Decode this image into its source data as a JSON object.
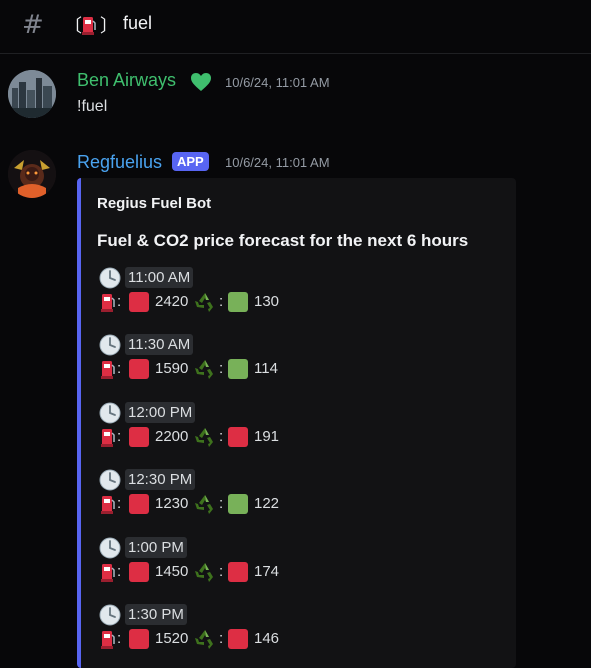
{
  "channel": {
    "name": "fuel",
    "open_bracket": "〔",
    "close_bracket": "〕",
    "hash_icon": "hash-icon",
    "emoji_icon": "fuel-pump-icon"
  },
  "messages": [
    {
      "author": "Ben Airways",
      "author_color": "#3fbf6e",
      "badge_icon": "green-heart-icon",
      "timestamp": "10/6/24, 11:01 AM",
      "text": "!fuel"
    },
    {
      "author": "Regfuelius",
      "author_color": "#4aa3f0",
      "badge": "APP",
      "timestamp": "10/6/24, 11:01 AM"
    }
  ],
  "embed": {
    "accent_color": "#5865f2",
    "author": "Regius Fuel Bot",
    "title": "Fuel & CO2 price forecast for the next 6 hours",
    "slots": [
      {
        "time": "11:00 AM",
        "fuel": "2420",
        "fuel_status": "red",
        "co2": "130",
        "co2_status": "green"
      },
      {
        "time": "11:30 AM",
        "fuel": "1590",
        "fuel_status": "red",
        "co2": "114",
        "co2_status": "green"
      },
      {
        "time": "12:00 PM",
        "fuel": "2200",
        "fuel_status": "red",
        "co2": "191",
        "co2_status": "red"
      },
      {
        "time": "12:30 PM",
        "fuel": "1230",
        "fuel_status": "red",
        "co2": "122",
        "co2_status": "green"
      },
      {
        "time": "1:00 PM",
        "fuel": "1450",
        "fuel_status": "red",
        "co2": "174",
        "co2_status": "red"
      },
      {
        "time": "1:30 PM",
        "fuel": "1520",
        "fuel_status": "red",
        "co2": "146",
        "co2_status": "red"
      }
    ],
    "colon": ":"
  },
  "colors": {
    "red_square": "#dd2e44",
    "green_square": "#78b159"
  }
}
